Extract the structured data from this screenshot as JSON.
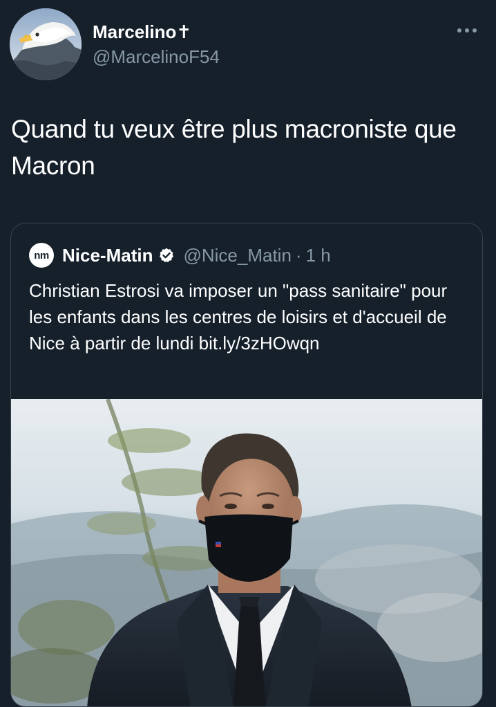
{
  "author": {
    "display_name": "Marcelino✝",
    "handle": "@MarcelinoF54",
    "avatar_icon": "eagle-avatar-icon"
  },
  "tweet": {
    "text": "Quand tu veux être plus macroniste que Macron"
  },
  "quoted_tweet": {
    "logo_text": "nm",
    "display_name": "Nice-Matin",
    "verified": true,
    "handle": "@Nice_Matin",
    "separator": "·",
    "time": "1 h",
    "text": "Christian Estrosi va imposer un \"pass sanitaire\" pour les enfants dans les centres de loisirs et d'accueil de Nice à partir de lundi bit.ly/3zHOwqn",
    "image_subject": "man-in-suit-wearing-black-mask"
  },
  "colors": {
    "background": "#15202b",
    "secondary_text": "#8899a6",
    "border": "#38444d"
  }
}
